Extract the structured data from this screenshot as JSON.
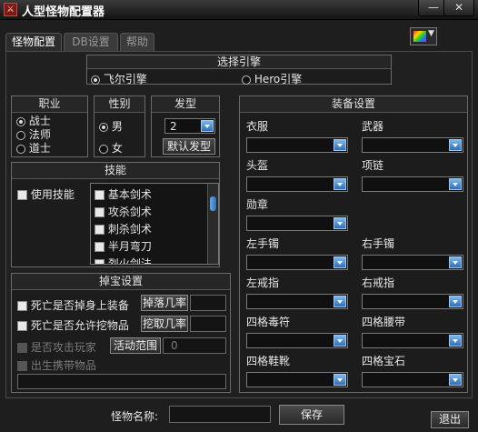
{
  "window": {
    "title": "人型怪物配置器",
    "app_icon": "monster-icon",
    "minimize": "—",
    "close": "✕"
  },
  "tabs": [
    {
      "label": "怪物配置",
      "active": true
    },
    {
      "label": "DB设置",
      "active": false
    },
    {
      "label": "帮助",
      "active": false
    }
  ],
  "engine": {
    "title": "选择引擎",
    "options": [
      {
        "label": "飞尔引擎",
        "selected": true
      },
      {
        "label": "Hero引擎",
        "selected": false
      }
    ]
  },
  "job": {
    "title": "职业",
    "options": [
      {
        "label": "战士",
        "selected": true
      },
      {
        "label": "法师",
        "selected": false
      },
      {
        "label": "道士",
        "selected": false
      }
    ]
  },
  "gender": {
    "title": "性别",
    "options": [
      {
        "label": "男",
        "selected": true
      },
      {
        "label": "女",
        "selected": false
      }
    ]
  },
  "hair": {
    "title": "发型",
    "value": "2",
    "default_label": "默认发型"
  },
  "skills": {
    "title": "技能",
    "use_label": "使用技能",
    "list": [
      "基本剑术",
      "攻杀剑术",
      "刺杀剑术",
      "半月弯刀",
      "烈火剑法"
    ]
  },
  "drop": {
    "title": "掉宝设置",
    "death_drop_label": "死亡是否掉身上装备",
    "drop_rate_label": "掉落几率",
    "allow_dig_label": "死亡是否允许挖物品",
    "dig_rate_label": "挖取几率",
    "attack_player_label": "是否攻击玩家",
    "range_label": "活动范围",
    "range_value": "0",
    "carry_label": "出生携带物品"
  },
  "equipment": {
    "title": "装备设置",
    "slots": [
      "衣服",
      "武器",
      "头盔",
      "项链",
      "勋章",
      "左手镯",
      "右手镯",
      "左戒指",
      "右戒指",
      "四格毒符",
      "四格腰带",
      "四格鞋靴",
      "四格宝石"
    ]
  },
  "footer": {
    "name_label": "怪物名称:",
    "name_value": "",
    "save_label": "保存",
    "exit_label": "退出"
  },
  "colors": {
    "accent": "#3a82d0",
    "background": "#1e1e1e"
  }
}
